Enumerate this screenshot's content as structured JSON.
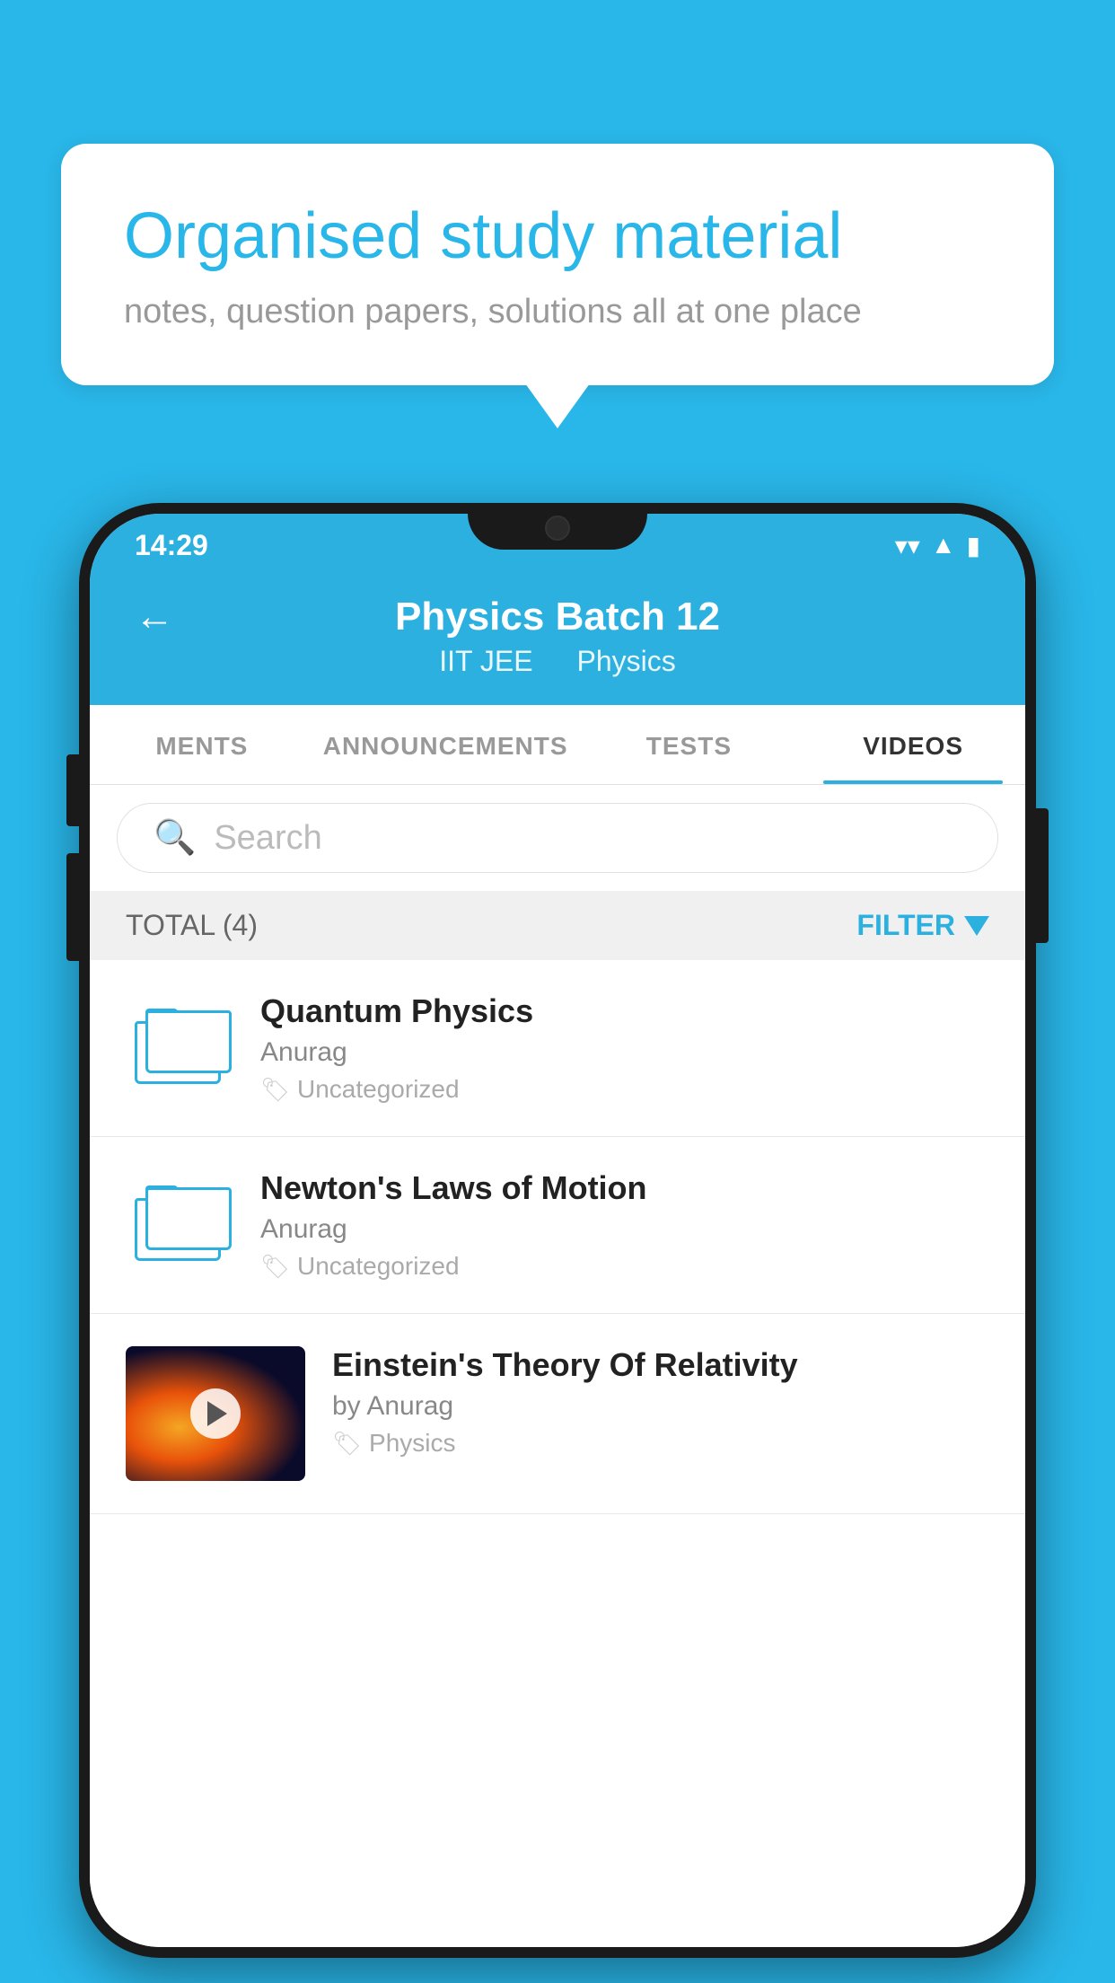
{
  "background_color": "#29b6e8",
  "speech_bubble": {
    "title": "Organised study material",
    "subtitle": "notes, question papers, solutions all at one place"
  },
  "phone": {
    "status_bar": {
      "time": "14:29",
      "wifi": "▾",
      "signal": "◂",
      "battery": "▮"
    },
    "header": {
      "back_label": "←",
      "title": "Physics Batch 12",
      "subtitle_part1": "IIT JEE",
      "subtitle_part2": "Physics"
    },
    "tabs": [
      {
        "label": "MENTS",
        "active": false
      },
      {
        "label": "ANNOUNCEMENTS",
        "active": false
      },
      {
        "label": "TESTS",
        "active": false
      },
      {
        "label": "VIDEOS",
        "active": true
      }
    ],
    "search": {
      "placeholder": "Search"
    },
    "filter": {
      "total_label": "TOTAL (4)",
      "filter_label": "FILTER"
    },
    "videos": [
      {
        "title": "Quantum Physics",
        "author": "Anurag",
        "tag": "Uncategorized",
        "has_thumbnail": false
      },
      {
        "title": "Newton's Laws of Motion",
        "author": "Anurag",
        "tag": "Uncategorized",
        "has_thumbnail": false
      },
      {
        "title": "Einstein's Theory Of Relativity",
        "author": "by Anurag",
        "tag": "Physics",
        "has_thumbnail": true
      }
    ]
  }
}
